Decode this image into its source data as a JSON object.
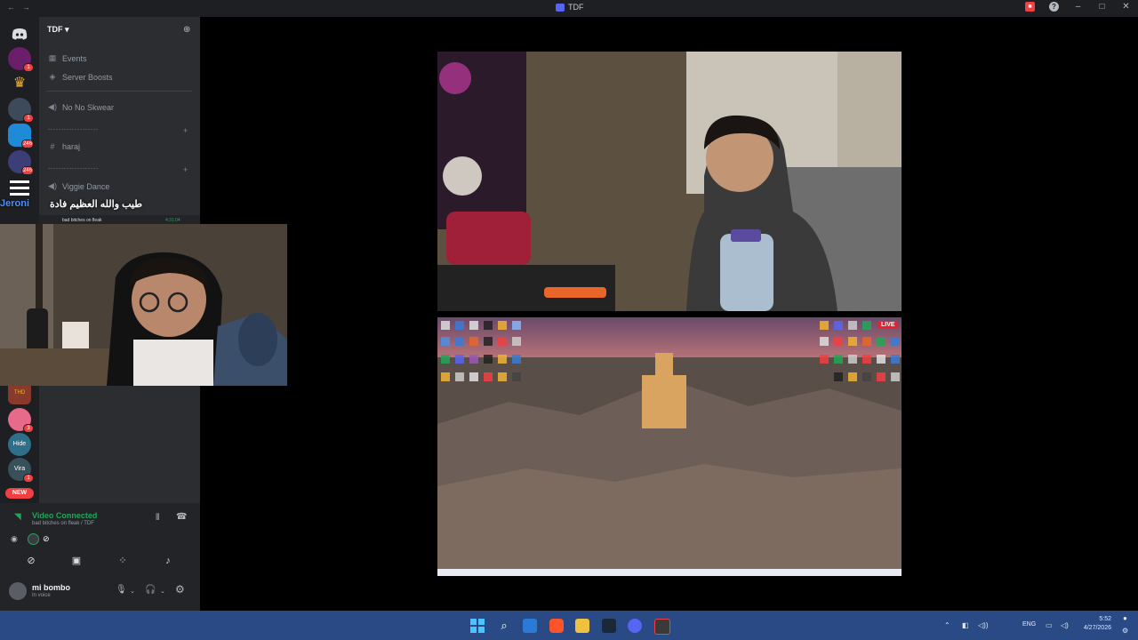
{
  "window": {
    "title": "TDF"
  },
  "server": {
    "name": "TDF",
    "channels": [
      {
        "label": "Events",
        "icon": "calendar-icon"
      },
      {
        "label": "Server Boosts",
        "icon": "boost-icon"
      },
      {
        "label": "No No Skwear",
        "icon": "speaker-icon"
      },
      {
        "label": "haraj",
        "icon": "hash-icon"
      },
      {
        "label": "Viggie Dance",
        "icon": "speaker-icon"
      }
    ],
    "categories": [
      "-------------------",
      "-------------------"
    ]
  },
  "guild_badges": [
    "1",
    "1",
    "246",
    "3",
    "1",
    "31"
  ],
  "guild_new_label": "NEW",
  "guild_labels": {
    "thd": "THD",
    "hide": "Hide",
    "vira": "Vira"
  },
  "overlay": {
    "speaker_name": "Jeroni",
    "message": "طيب والله العظيم فادة",
    "status_text": "bad bitches on fleak",
    "timer": "4:31:04"
  },
  "voice": {
    "title": "Video Connected",
    "subtitle": "bad bitches on fleak / TDF"
  },
  "user": {
    "name": "mi bombo",
    "status": "In voice"
  },
  "stream": {
    "live_label": "LIVE"
  },
  "taskbar": {
    "lang": "ENG",
    "time": "5:52",
    "date": "4/27/2026"
  },
  "colors": {
    "accent": "#5865f2",
    "connected": "#23a559",
    "danger": "#f23f42",
    "taskbar": "#2a4a86"
  }
}
